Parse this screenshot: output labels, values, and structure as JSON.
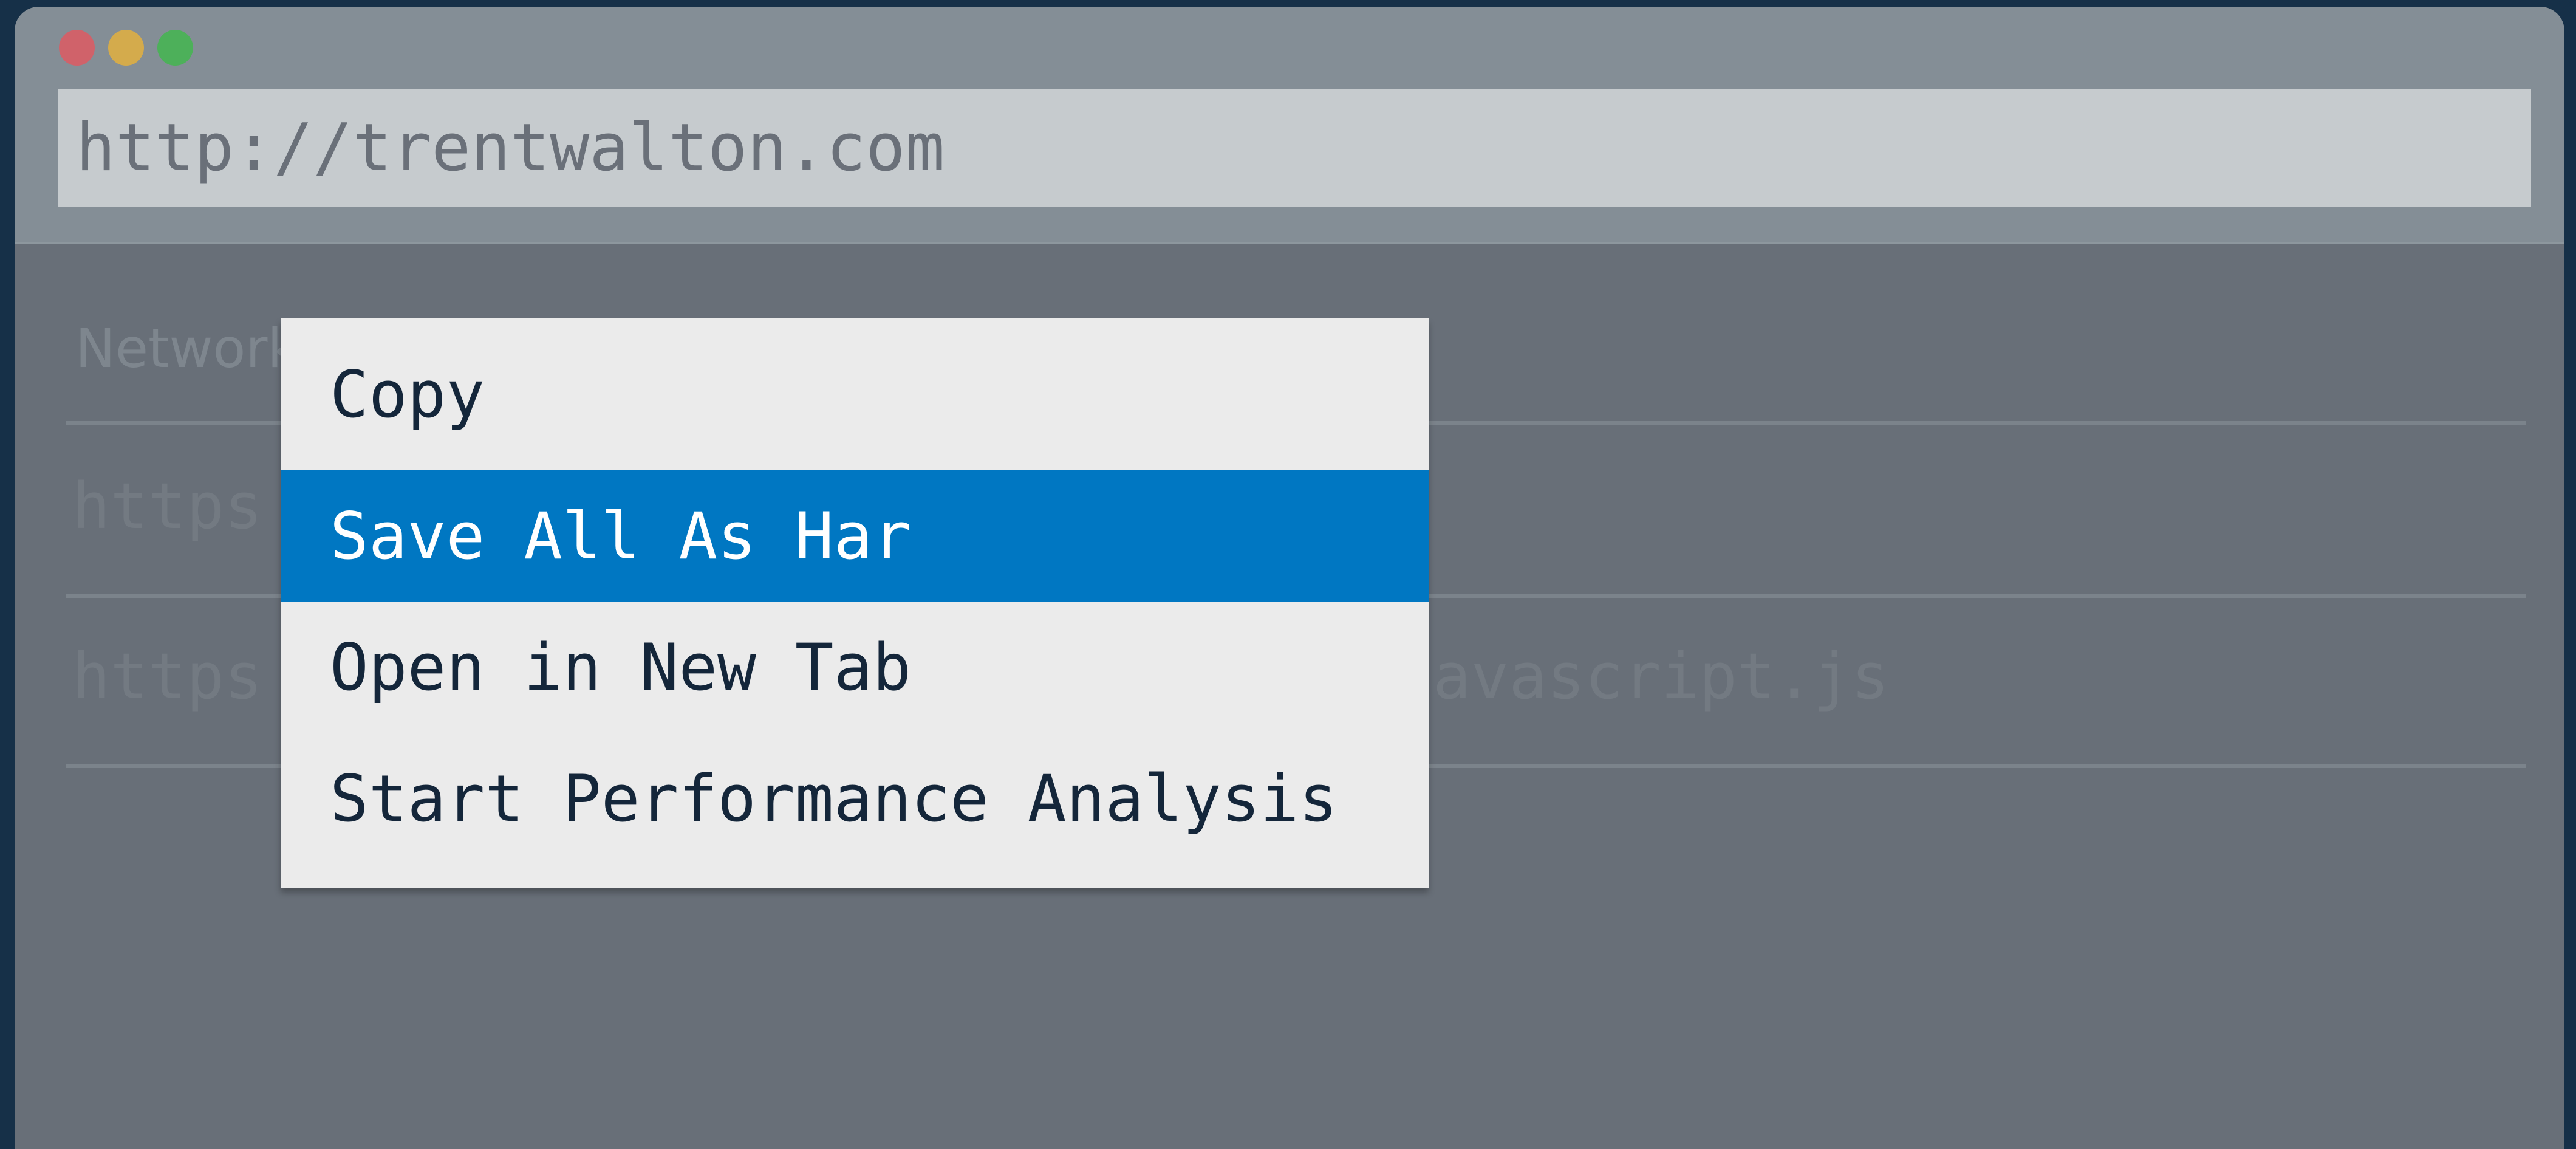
{
  "window": {
    "url": "http://trentwalton.com",
    "traffic_lights": [
      "close",
      "minimize",
      "zoom"
    ]
  },
  "network_panel": {
    "title": "Network",
    "requests": [
      {
        "prefix": "https"
      },
      {
        "prefix": "https",
        "tail": "avascript.js"
      }
    ]
  },
  "context_menu": {
    "items": [
      {
        "label": "Copy",
        "highlighted": false
      },
      {
        "label": "Save All As Har",
        "highlighted": true
      },
      {
        "label": "Open in New Tab",
        "highlighted": false
      },
      {
        "label": "Start Performance Analysis",
        "highlighted": false
      }
    ],
    "highlight_color": "#0077c2"
  },
  "colors": {
    "background": "#163048",
    "titlebar": "#848e96",
    "content": "#686f78",
    "menu": "#ebebeb"
  }
}
